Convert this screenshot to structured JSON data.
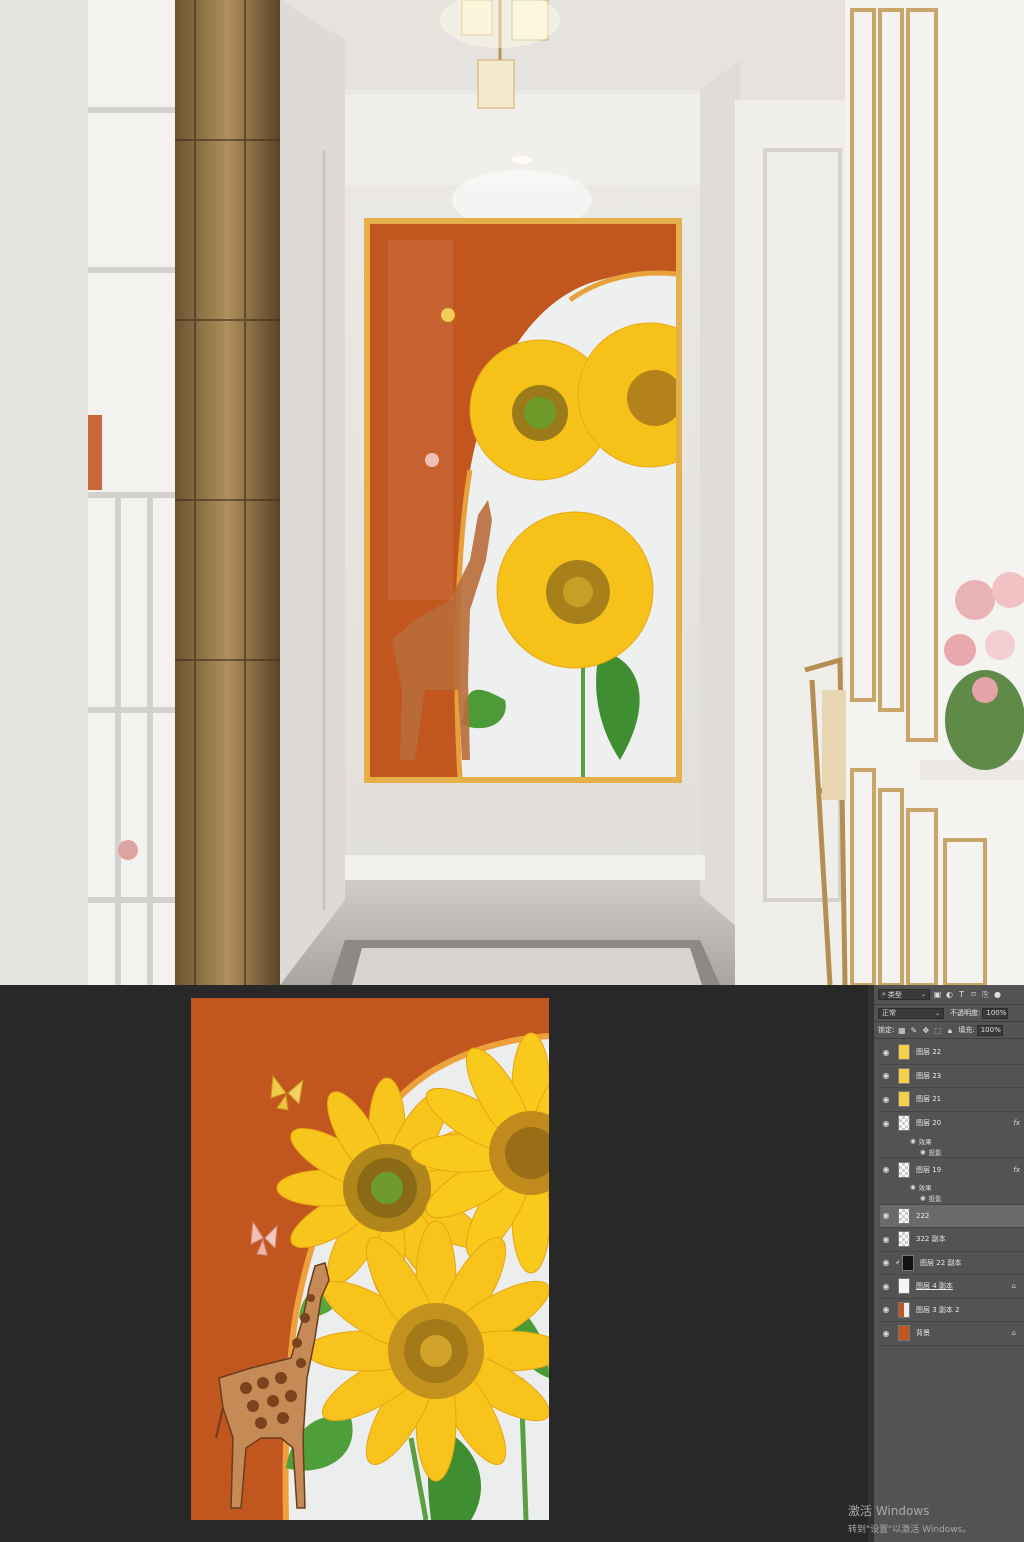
{
  "panel": {
    "filter_kind": "类型",
    "blend_mode": "正常",
    "opacity_label": "不透明度:",
    "opacity_value": "100%",
    "lock_label": "锁定:",
    "fill_label": "填充:",
    "fill_value": "100%",
    "layers": [
      {
        "name": "图层 22",
        "thumb": "sunflower"
      },
      {
        "name": "图层 23",
        "thumb": "sunflower"
      },
      {
        "name": "图层 21",
        "thumb": "sunflower"
      },
      {
        "name": "图层 20",
        "fx": "fx",
        "effects_label": "效果",
        "effect": "投影"
      },
      {
        "name": "图层 19",
        "fx": "fx",
        "effects_label": "效果",
        "effect": "投影"
      },
      {
        "name": "222",
        "selected": true
      },
      {
        "name": "322 副本"
      },
      {
        "name": "图层 22 副本",
        "thumb": "mask"
      },
      {
        "name": "图层 4 副本",
        "locked": true
      },
      {
        "name": "图层 3 副本 2",
        "thumb": "orange"
      },
      {
        "name": "背景",
        "thumb": "solid-orange",
        "locked": true
      }
    ]
  },
  "icons": {
    "eye": "eye-icon",
    "lock": "lock-icon",
    "search": "search-icon"
  },
  "watermark": {
    "line1": "激活 Windows",
    "line2": "转到\"设置\"以激活 Windows。"
  },
  "colors": {
    "art_background": "#c2561f",
    "frame_gold": "#d9a43a",
    "sunflower_yellow": "#f6c21a",
    "panel_bg": "#535353",
    "workspace_bg": "#282828"
  }
}
